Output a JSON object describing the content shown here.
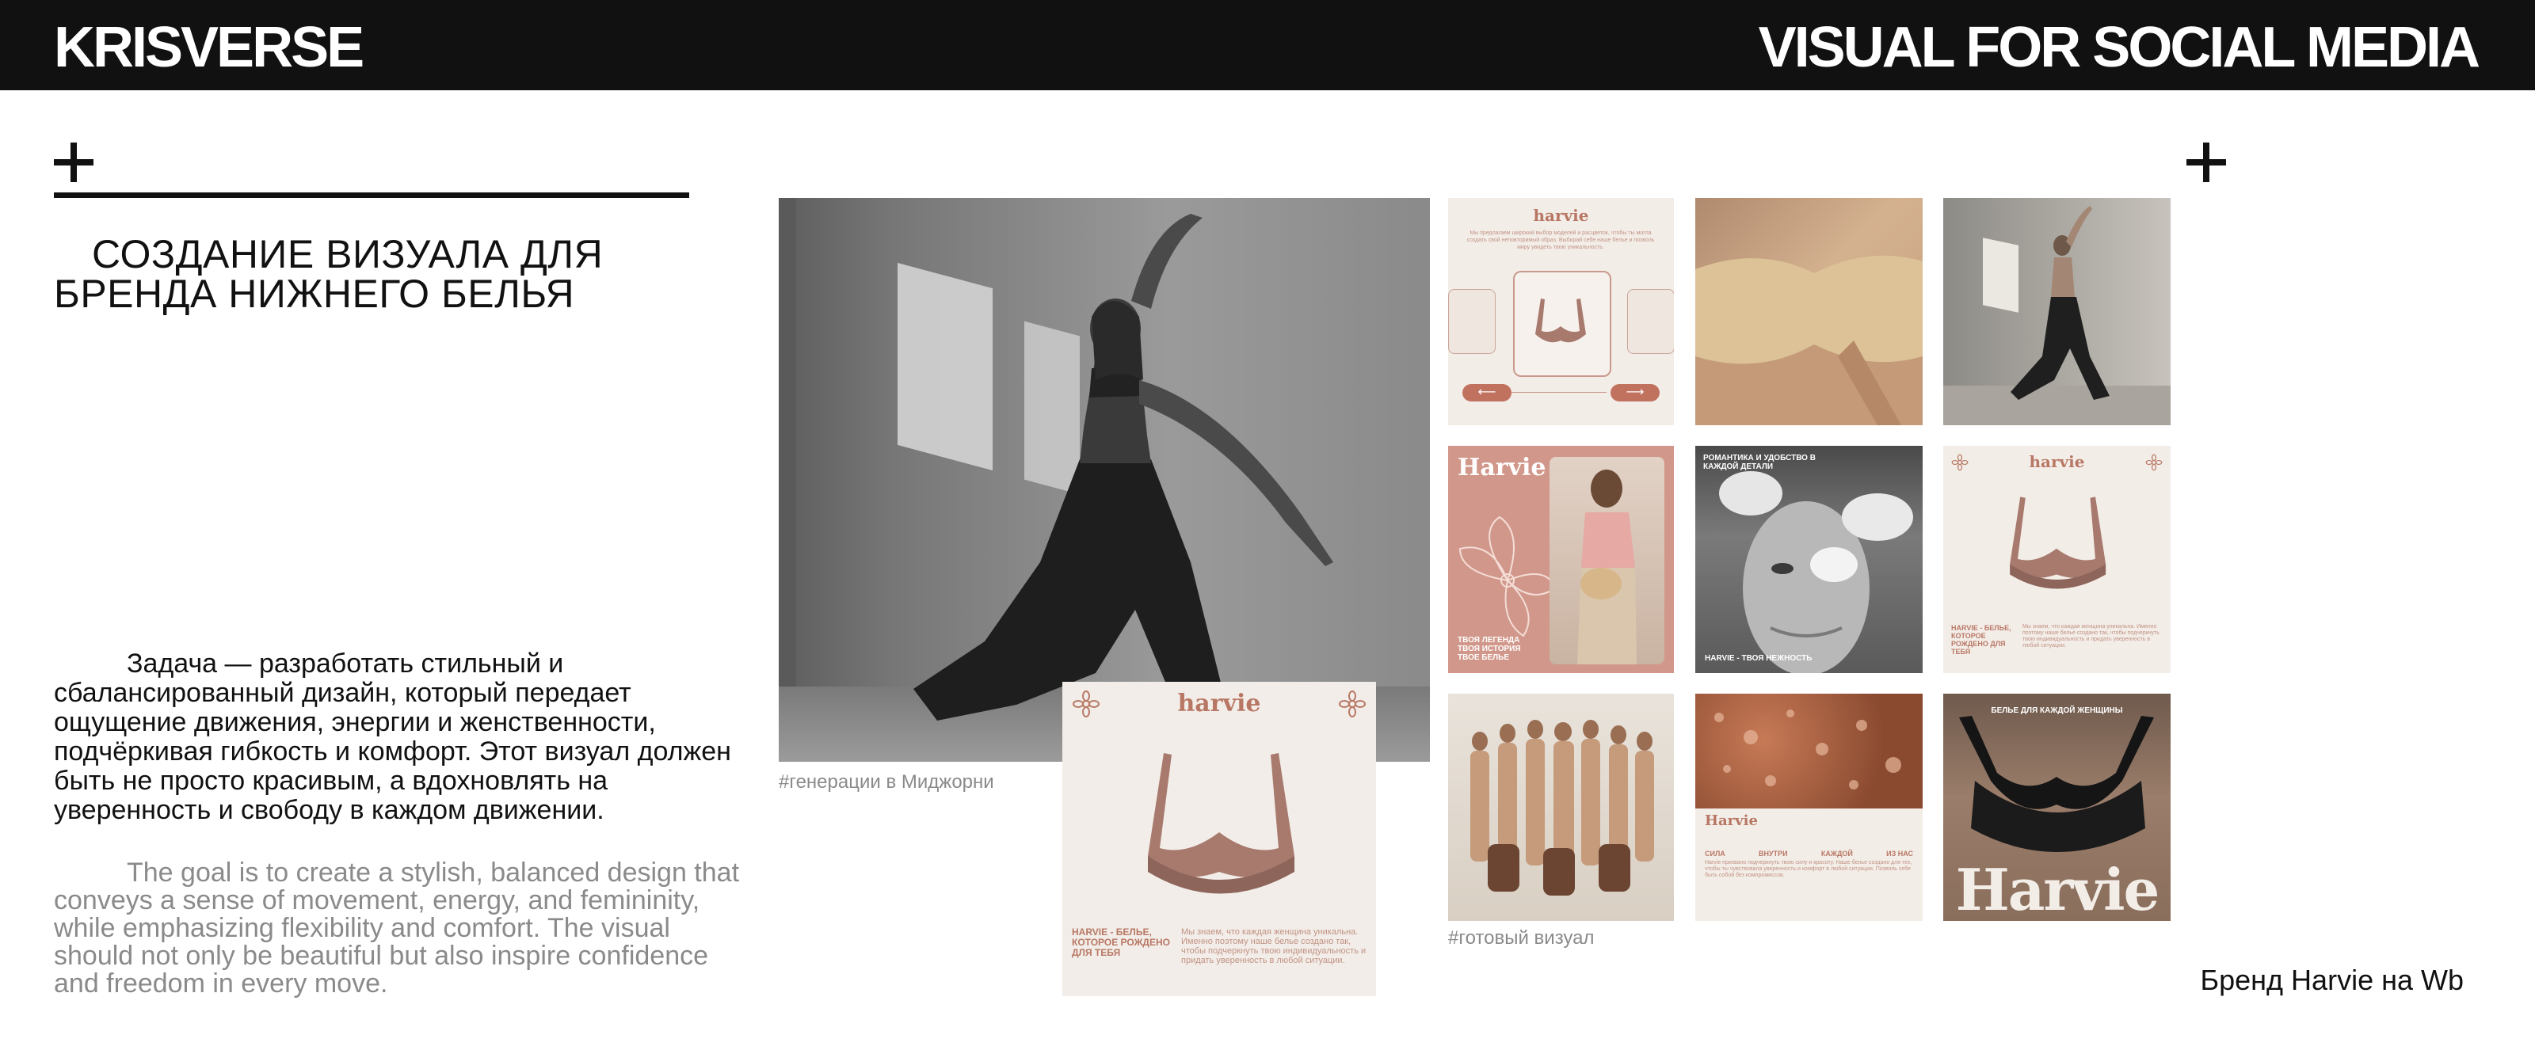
{
  "header": {
    "brand": "KRISVERSE",
    "tagline": "VISUAL FOR SOCIAL MEDIA"
  },
  "intro": {
    "headline": "СОЗДАНИЕ ВИЗУАЛА ДЛЯ БРЕНДА НИЖНЕГО БЕЛЬЯ",
    "task_ru": "Задача — разработать стильный и сбалансированный дизайн, который передает ощущение движения, энергии и женственности, подчёркивая гибкость и комфорт. Этот визуал должен быть не просто красивым, а вдохновлять на уверенность и свободу в каждом движении.",
    "task_en": "The goal is to create a stylish, balanced design that conveys a sense of movement, energy, and femininity, while emphasizing flexibility and comfort. The visual should not only be beautiful but also inspire confidence and freedom in every move."
  },
  "captions": {
    "generated": "#генерации в Миджорни",
    "final": "#готовый визуал",
    "brand_note": "Бренд Harvie на Wb"
  },
  "cards": {
    "logo": "harvie",
    "logo_bold": "Harvie",
    "slogan": "HARVIE - БЕЛЬЕ, КОТОРОЕ РОЖДЕНО ДЛЯ ТЕБЯ",
    "body_text": "Мы знаем, что каждая женщина уникальна. Именно поэтому наше белье создано так, чтобы подчеркнуть твою индивидуальность и придать уверенность в любой ситуации.",
    "top_text": "Мы предлагаем широкий выбор моделей и расцветок, чтобы ты могла создать свой неповторимый образ. Выбирай себе наше белье и позволь миру увидеть твою уникальность.",
    "legend_text": "ТВОЯ ЛЕГЕНДА ТВОЯ ИСТОРИЯ ТВОЕ БЕЛЬЕ",
    "romance_title": "РОМАНТИКА И УДОБСТВО В КАЖДОЙ ДЕТАЛИ",
    "tenderness": "HARVIE - ТВОЯ НЕЖНОСТЬ",
    "power_words": [
      "СИЛА",
      "ВНУТРИ",
      "КАЖДОЙ",
      "ИЗ НАС"
    ],
    "power_text": "Harvie призвано подчеркнуть твою силу и красоту. Наше белье создано для тех, чтобы ты чувствовала уверенность и комфорт в любой ситуации. Позволь себе быть собой без компромиссов.",
    "every_woman": "БЕЛЬЕ ДЛЯ КАЖДОЙ ЖЕНЩИНЫ"
  },
  "colors": {
    "header_bg": "#111111",
    "accent_rose": "#b87764",
    "card_cream": "#f2ede8",
    "caption_gray": "#8a8a8a"
  }
}
